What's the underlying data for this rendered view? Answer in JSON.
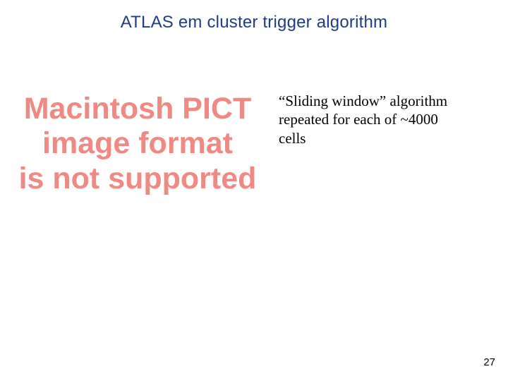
{
  "title": "ATLAS em cluster trigger algorithm",
  "pict": {
    "line1": "Macintosh PICT",
    "line2": "image format",
    "line3": "is not supported"
  },
  "caption": "“Sliding window” algorithm repeated for each of ~4000 cells",
  "page_number": "27"
}
